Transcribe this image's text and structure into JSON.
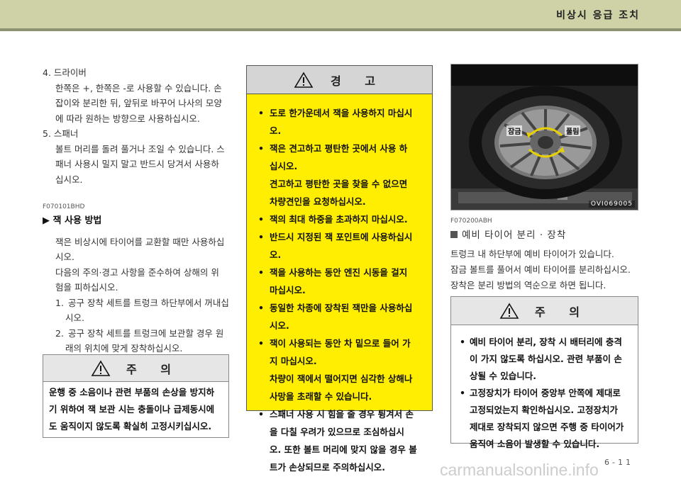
{
  "header": {
    "title": "비상시 응급 조치"
  },
  "left": {
    "items": [
      {
        "head": "4. 드라이버",
        "lines": [
          "한쪽은 +, 한쪽은 -로 사용할 수 있습니다. 손",
          "잡이와 분리한 뒤, 앞뒤로 바꾸어 나사의 모양",
          "에 따라 원하는 방향으로 사용하십시오."
        ]
      },
      {
        "head": "5. 스패너",
        "lines": [
          "볼트 머리를 돌려 풀거나 조일 수 있습니다. 스",
          "패너 사용시 밀지 말고 반드시 당겨서 사용하",
          "십시오."
        ]
      }
    ],
    "code": "F070101BHD",
    "section_title": "▶ 잭 사용 방법",
    "paras": [
      "잭은 비상시에 타이어를 교환할 때만 사용하십",
      "시오.",
      "다음의 주의·경고 사항을 준수하여 상해의 위",
      "험을 피하십시오."
    ],
    "steps": [
      {
        "num": "1.",
        "first": "공구 장착 세트를 트렁크 하단부에서 꺼내십",
        "rest": "시오."
      },
      {
        "num": "2.",
        "first": "공구 장착 세트를 트렁크에 보관할 경우 원",
        "rest": "래의 위치에 맞게 장착하십시오."
      }
    ]
  },
  "left_caution": {
    "title": "주 의",
    "lines": [
      "운행 중 소음이나 관련 부품의 손상을 방지하",
      "기 위하여 잭 보관 시는 충돌이나 급제동시에",
      "도 움직이지 않도록 확실히 고정시키십시오."
    ]
  },
  "warning": {
    "title": "경 고",
    "items": [
      [
        "도로 한가운데서 잭을 사용하지 마십시오."
      ],
      [
        "잭은 견고하고 평탄한 곳에서 사용 하",
        "십시오.",
        "견고하고 평탄한 곳을 찾을 수 없으면",
        "차량견인을 요청하십시오."
      ],
      [
        "잭의 최대 하중을 초과하지 마십시오."
      ],
      [
        "반드시 지정된 잭 포인트에 사용하십시오."
      ],
      [
        "잭을 사용하는 동안 엔진 시동을 걸지",
        "마십시오."
      ],
      [
        "동일한 차종에 장착된 잭만을 사용하십",
        "시오."
      ],
      [
        "잭이 사용되는 동안 차 밑으로 들어 가",
        "지 마십시오.",
        "차량이 잭에서 떨어지면 심각한 상해나",
        "사망을 초래할 수 있습니다."
      ],
      [
        "스패너 사용 시 힘을 줄 경우 튕겨서 손",
        "을 다칠 우려가 있으므로 조심하십시",
        "오. 또한 볼트 머리에 맞지 않을 경우 볼",
        "트가 손상되므로 주의하십시오."
      ]
    ]
  },
  "photo": {
    "label_left": "잠금",
    "label_right": "풀림",
    "code": "OVI069005"
  },
  "right": {
    "code": "F070200ABH",
    "section_title": "예비 타이어 분리 · 장착",
    "lines": [
      "트렁크 내 하단부에 예비 타이어가 있습니다.",
      "잠금 볼트를 풀어서 예비 타이어를 분리하십시오.",
      "장착은 분리 방법의 역순으로 하면 됩니다."
    ]
  },
  "right_caution": {
    "title": "주 의",
    "items": [
      [
        "예비 타이어 분리, 장착 시 배터리에 충격",
        "이 가지 않도록 하십시오. 관련 부품이 손",
        "상될 수 있습니다."
      ],
      [
        "고정장치가 타이어 중앙부 안쪽에 제대로",
        "고정되었는지 확인하십시오. 고정장치가",
        "제대로 장착되지 않으면 주행 중 타이어가",
        "움직여 소음이 발생할 수 있습니다."
      ]
    ]
  },
  "footer": {
    "page": "6-11",
    "watermark": "carmanualsonline.info"
  }
}
